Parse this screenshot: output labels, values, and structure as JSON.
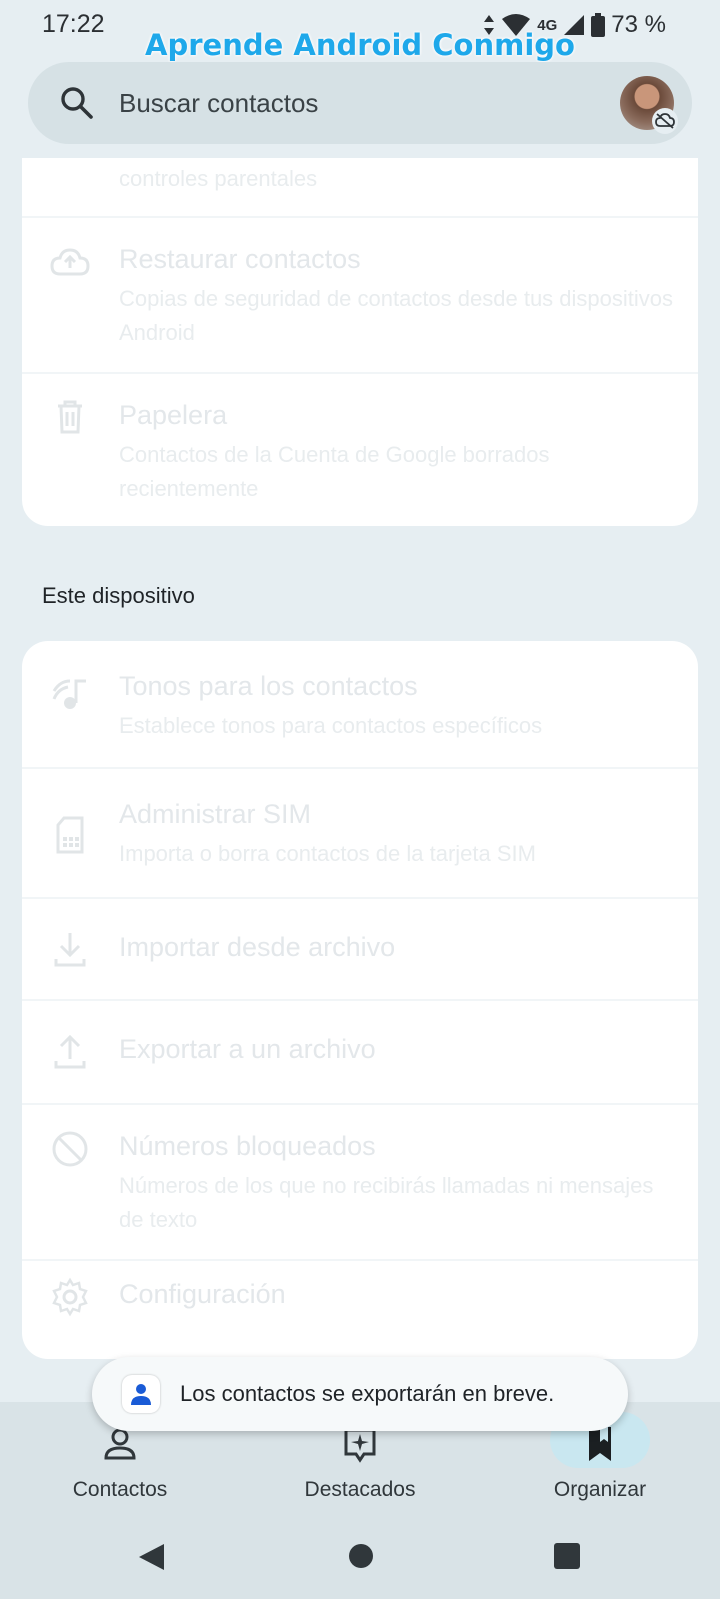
{
  "status_bar": {
    "time": "17:22",
    "network": "4G",
    "battery": "73 %"
  },
  "watermark": "Aprende Android Conmigo",
  "search": {
    "placeholder": "Buscar contactos",
    "icon": "search-icon"
  },
  "account": {
    "icon": "avatar",
    "badge_icon": "cloud-off-icon"
  },
  "cloud_section": {
    "items": [
      {
        "title": "",
        "subtitle": "controles parentales",
        "icon": ""
      },
      {
        "title": "Restaurar contactos",
        "subtitle": "Copias de seguridad de contactos desde tus dispositivos Android",
        "icon": "cloud-restore-icon"
      },
      {
        "title": "Papelera",
        "subtitle": "Contactos de la Cuenta de Google borrados recientemente",
        "icon": "trash-icon"
      }
    ]
  },
  "device_section": {
    "header": "Este dispositivo",
    "items": [
      {
        "title": "Tonos para los contactos",
        "subtitle": "Establece tonos para contactos específicos",
        "icon": "ringtone-icon"
      },
      {
        "title": "Administrar SIM",
        "subtitle": "Importa o borra contactos de la tarjeta SIM",
        "icon": "sim-card-icon"
      },
      {
        "title": "Importar desde archivo",
        "subtitle": "",
        "icon": "download-icon"
      },
      {
        "title": "Exportar a un archivo",
        "subtitle": "",
        "icon": "upload-icon"
      },
      {
        "title": "Números bloqueados",
        "subtitle": "Números de los que no recibirás llamadas ni mensajes de texto",
        "icon": "block-icon"
      },
      {
        "title": "Configuración",
        "subtitle": "",
        "icon": "gear-icon"
      }
    ]
  },
  "snackbar": {
    "text": "Los contactos se exportarán en breve.",
    "icon": "contacts-app-icon"
  },
  "bottom_nav": {
    "items": [
      {
        "label": "Contactos",
        "icon": "person-icon",
        "selected": false
      },
      {
        "label": "Destacados",
        "icon": "highlights-icon",
        "selected": false
      },
      {
        "label": "Organizar",
        "icon": "bookmark-icon",
        "selected": true
      }
    ]
  },
  "system_nav": {
    "back": "back-icon",
    "home": "home-icon",
    "recents": "recents-icon"
  },
  "colors": {
    "accent": "#1ea8ea",
    "background": "#e6eef2",
    "nav_bar": "#d9e3e7",
    "selected_pill": "#c9e7f0"
  }
}
